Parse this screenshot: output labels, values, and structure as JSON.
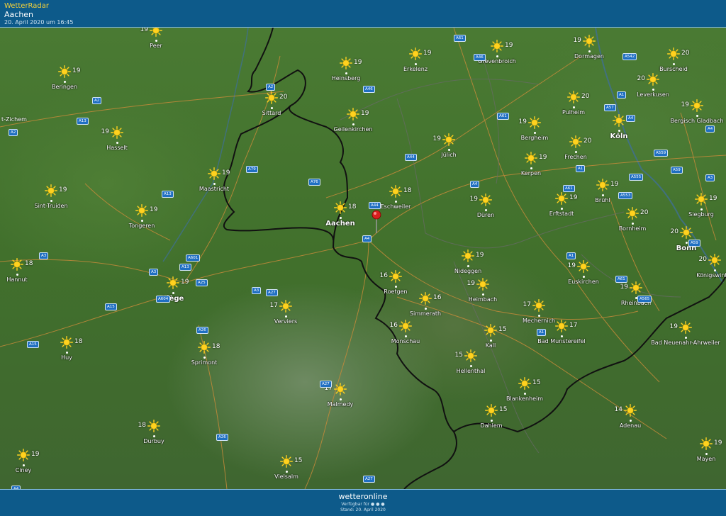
{
  "header": {
    "app_title": "WetterRadar",
    "location": "Aachen",
    "timestamp": "20. April 2020 um 16:45"
  },
  "footer": {
    "brand": "wetteronline",
    "availability": "Verfügbar für ● ● ●",
    "stand": "Stand: 20. April 2020"
  },
  "colors": {
    "header_bg": "#0d5a8a",
    "app_title": "#f5d23a",
    "map_green": "#4a7a33",
    "road_badge": "#1f6fc2",
    "sun": "#ffd21f",
    "pin": "#d91f1f"
  },
  "icons": {
    "weather": "sun-icon",
    "location": "map-pin-icon"
  },
  "cities": [
    {
      "name": "Peer",
      "temp": "19"
    },
    {
      "name": "Beringen",
      "temp": "19"
    },
    {
      "name": "Hasselt",
      "temp": "19"
    },
    {
      "name": "Sint-Truiden",
      "temp": "19"
    },
    {
      "name": "Tongeren",
      "temp": "19"
    },
    {
      "name": "Hannut",
      "temp": "18"
    },
    {
      "name": "Liège",
      "temp": "19"
    },
    {
      "name": "Huy",
      "temp": "18"
    },
    {
      "name": "Sprimont",
      "temp": "18"
    },
    {
      "name": "Durbuy",
      "temp": "18"
    },
    {
      "name": "Ciney",
      "temp": "19"
    },
    {
      "name": "Vielsalm",
      "temp": "15"
    },
    {
      "name": "Malmedy",
      "temp": "17"
    },
    {
      "name": "Verviers",
      "temp": "17"
    },
    {
      "name": "Maastricht",
      "temp": "19"
    },
    {
      "name": "Sittard",
      "temp": "20"
    },
    {
      "name": "Heinsberg",
      "temp": "19"
    },
    {
      "name": "Geilenkirchen",
      "temp": "19"
    },
    {
      "name": "Erkelenz",
      "temp": "19"
    },
    {
      "name": "Grevenbroich",
      "temp": "19"
    },
    {
      "name": "Dormagen",
      "temp": "19"
    },
    {
      "name": "Burscheid",
      "temp": "20"
    },
    {
      "name": "Leverkusen",
      "temp": "20"
    },
    {
      "name": "Bergisch Gladbach",
      "temp": "19"
    },
    {
      "name": "Pulheim",
      "temp": "20"
    },
    {
      "name": "Köln",
      "temp": "20"
    },
    {
      "name": "Bergheim",
      "temp": "19"
    },
    {
      "name": "Frechen",
      "temp": "20"
    },
    {
      "name": "Jülich",
      "temp": "19"
    },
    {
      "name": "Kerpen",
      "temp": "19"
    },
    {
      "name": "Eschweiler",
      "temp": "18"
    },
    {
      "name": "Aachen",
      "temp": "18"
    },
    {
      "name": "Düren",
      "temp": "19"
    },
    {
      "name": "Erftstadt",
      "temp": "19"
    },
    {
      "name": "Brühl",
      "temp": "19"
    },
    {
      "name": "Siegburg",
      "temp": "19"
    },
    {
      "name": "Bornheim",
      "temp": "20"
    },
    {
      "name": "Bonn",
      "temp": "20"
    },
    {
      "name": "Königswinter",
      "temp": "20"
    },
    {
      "name": "Nideggen",
      "temp": "19"
    },
    {
      "name": "Roetgen",
      "temp": "16"
    },
    {
      "name": "Heimbach",
      "temp": "19"
    },
    {
      "name": "Euskirchen",
      "temp": "19"
    },
    {
      "name": "Rheinbach",
      "temp": "19"
    },
    {
      "name": "Simmerath",
      "temp": "16"
    },
    {
      "name": "Monschau",
      "temp": "16"
    },
    {
      "name": "Mechernich",
      "temp": "17"
    },
    {
      "name": "Kall",
      "temp": "15"
    },
    {
      "name": "Bad Munstereifel",
      "temp": "17"
    },
    {
      "name": "Bad Neuenahr-Ahrweiler",
      "temp": "19"
    },
    {
      "name": "Hellenthal",
      "temp": "15"
    },
    {
      "name": "Blankenheim",
      "temp": "15"
    },
    {
      "name": "Dahlem",
      "temp": "15"
    },
    {
      "name": "Adenau",
      "temp": "14"
    },
    {
      "name": "Mayen",
      "temp": "19"
    }
  ],
  "edge_label": "t-Zichem",
  "roads": [
    "A2",
    "A2",
    "A13",
    "A2",
    "A79",
    "A76",
    "A13",
    "A3",
    "A601",
    "A13",
    "A3",
    "A25",
    "A604",
    "A3",
    "A15",
    "A15",
    "A26",
    "A27",
    "A26",
    "A27",
    "A27",
    "A61",
    "A46",
    "A46",
    "A542",
    "A1",
    "A57",
    "A61",
    "A4",
    "A44",
    "A4",
    "A44",
    "A4",
    "A61",
    "A553",
    "A555",
    "A559",
    "A1",
    "A59",
    "A3",
    "A4",
    "A1",
    "A61",
    "A565",
    "A1",
    "A59",
    "A4"
  ]
}
